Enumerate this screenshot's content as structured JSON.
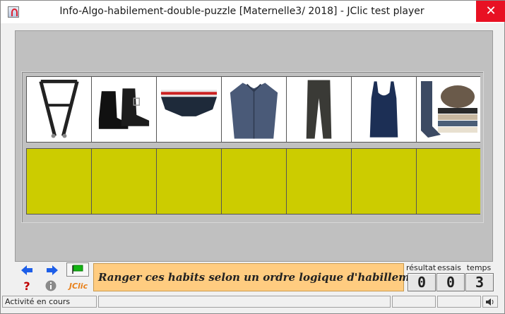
{
  "window": {
    "title": "Info-Algo-habilement-double-puzzle [Maternelle3/ 2018] - JClic test player",
    "close_label": "✕"
  },
  "puzzle": {
    "items": [
      {
        "name": "suspenders"
      },
      {
        "name": "boots"
      },
      {
        "name": "briefs"
      },
      {
        "name": "shirt"
      },
      {
        "name": "trousers"
      },
      {
        "name": "tank-top"
      },
      {
        "name": "socks"
      }
    ],
    "slot_color": "#cccc00"
  },
  "toolbar": {
    "prev_icon": "blue-arrow-left",
    "next_icon": "blue-arrow-right",
    "flag_icon": "green-flag",
    "help_icon": "question-mark",
    "info_icon": "info",
    "jclic_label": "JClic"
  },
  "message": "Ranger ces habits selon un ordre  logique d'habillement!",
  "counters": {
    "score_label": "résultat",
    "score": "0",
    "tries_label": "essais",
    "tries": "0",
    "time_label": "temps",
    "time": "3"
  },
  "status": {
    "text": "Activité en cours"
  }
}
